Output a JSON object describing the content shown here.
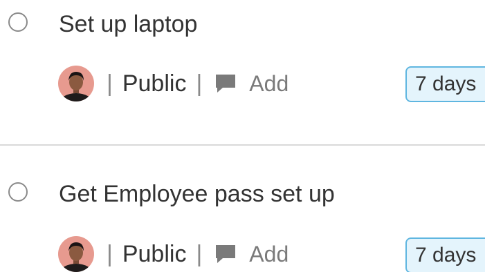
{
  "colors": {
    "title_text": "#333333",
    "muted_text": "#7a7a7a",
    "separator": "#8a8a8a",
    "badge_border": "#5fb6e0",
    "badge_fill": "#e4f4fc",
    "divider": "#d9d9d9"
  },
  "meta": {
    "separator": "|"
  },
  "tasks": [
    {
      "title": "Set up laptop",
      "visibility": "Public",
      "comment_label": "Add",
      "due": "7 days",
      "checked": false,
      "icons": {
        "checkbox": "circle-checkbox-icon",
        "avatar": "user-avatar",
        "comment": "comment-bubble-icon"
      }
    },
    {
      "title": "Get Employee pass set up",
      "visibility": "Public",
      "comment_label": "Add",
      "due": "7 days",
      "checked": false,
      "icons": {
        "checkbox": "circle-checkbox-icon",
        "avatar": "user-avatar",
        "comment": "comment-bubble-icon"
      }
    }
  ]
}
